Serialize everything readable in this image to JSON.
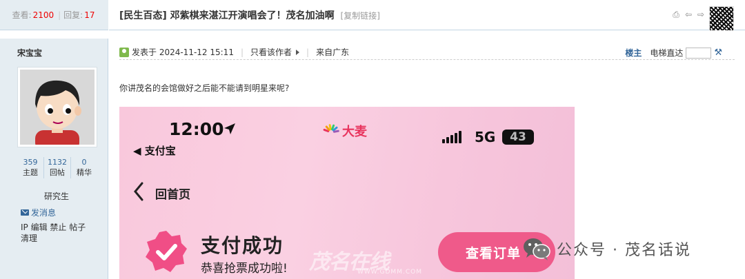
{
  "stats": {
    "views_label": "查看:",
    "views_value": "2100",
    "replies_label": "回复:",
    "replies_value": "17"
  },
  "thread": {
    "title": "[民生百态] 邓紫棋来湛江开演唱会了！茂名加油啊",
    "copy_link": "[复制链接]"
  },
  "author": {
    "name": "宋宝宝",
    "topics_value": "359",
    "topics_label": "主题",
    "posts_value": "1132",
    "posts_label": "回帖",
    "digest_value": "0",
    "digest_label": "精华",
    "rank": "研究生",
    "send_message": "发消息",
    "admin_links": "IP 编辑 禁止 帖子 清理"
  },
  "post_header": {
    "posted_at": "发表于 2024-11-12 15:11",
    "only_author": "只看该作者",
    "origin": "来自广东",
    "floor_label": "楼主",
    "jump_label": "电梯直达"
  },
  "post": {
    "text": "你讲茂名的会馆做好之后能不能请到明星来呢?"
  },
  "screenshot": {
    "time": "12:00",
    "back_app": "◀ 支付宝",
    "brand": "大麦",
    "network": "5G",
    "battery": "43",
    "back_home": "回首页",
    "success_title": "支付成功",
    "success_sub": "恭喜抢票成功啦!",
    "order_button": "查看订单",
    "watermark": "茂名在线",
    "watermark_url": "WWW.GDMM.COM"
  },
  "overlay": {
    "wechat_text": "公众号 · 茂名话说"
  },
  "colors": {
    "highlight_red": "#ee0000",
    "link_blue": "#336699",
    "brand_pink": "#e8345e",
    "order_button": "#ef5a8a"
  }
}
